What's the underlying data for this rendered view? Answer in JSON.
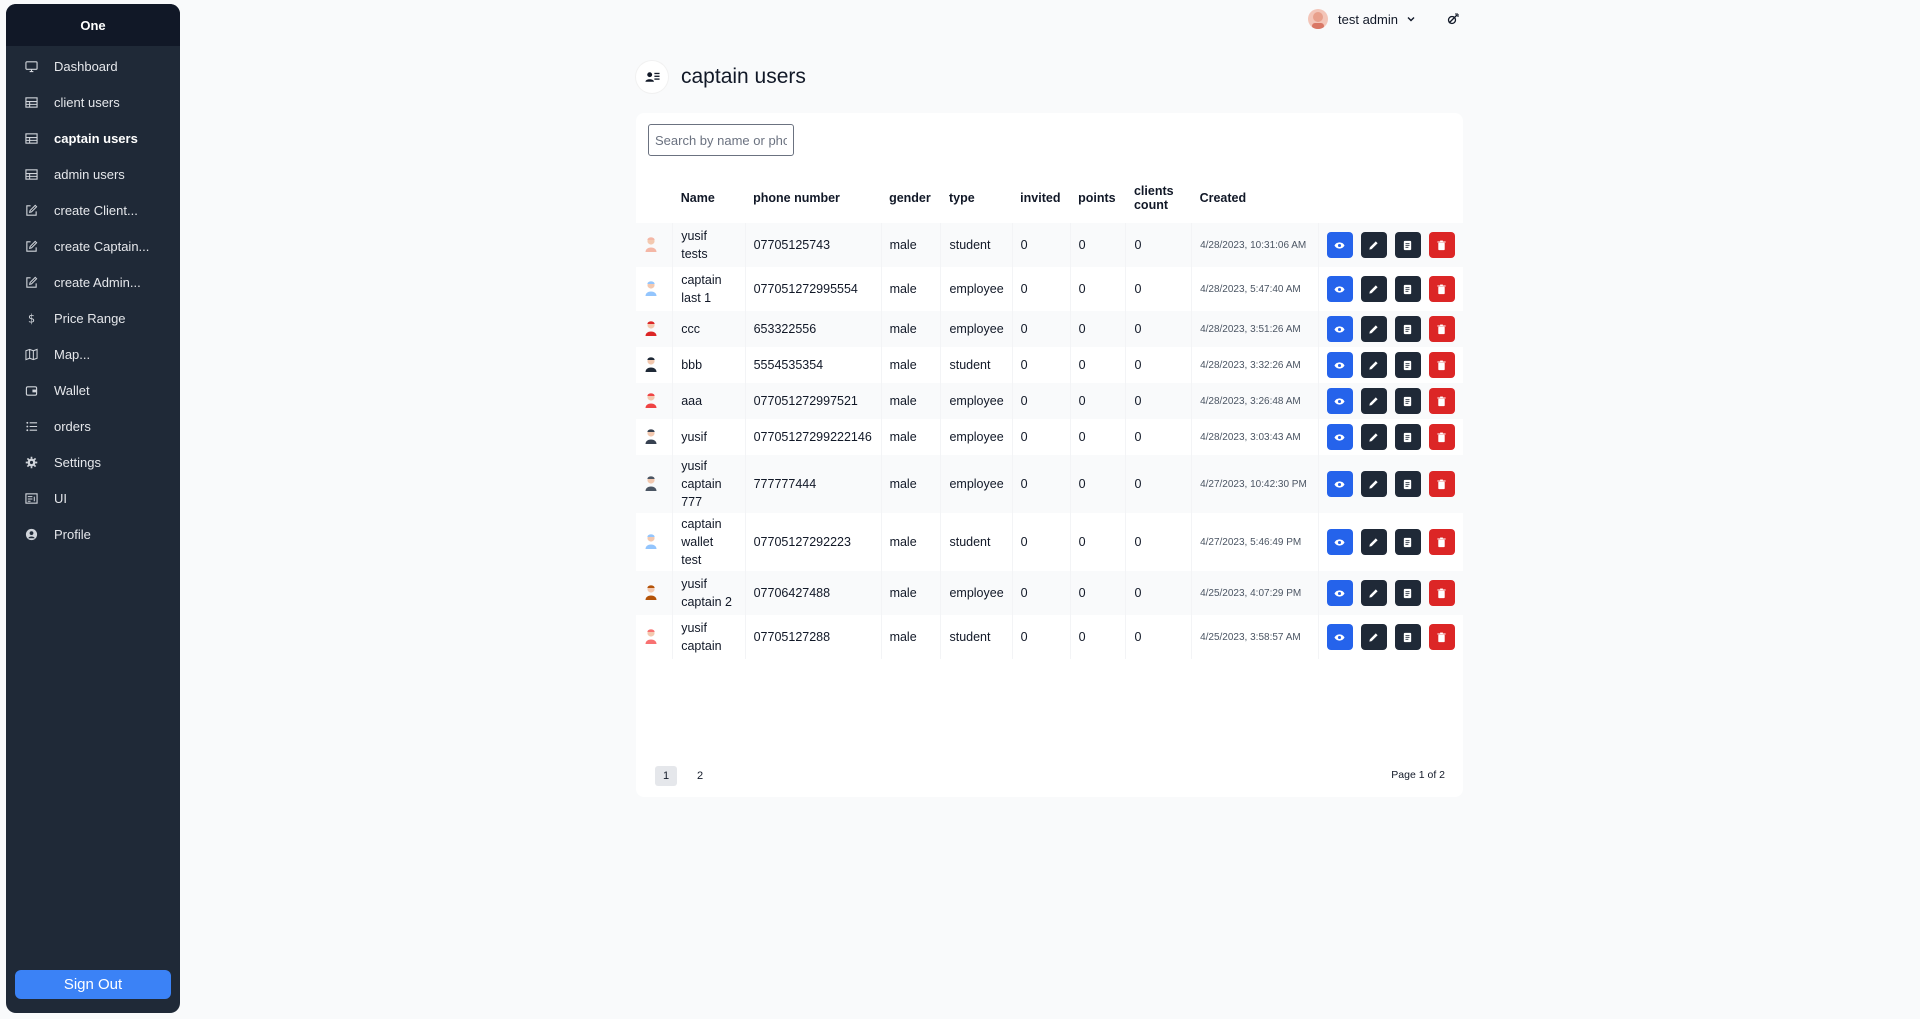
{
  "app": {
    "brand": "One"
  },
  "sidebar": {
    "items": [
      {
        "label": "Dashboard",
        "icon": "monitor-icon"
      },
      {
        "label": "client users",
        "icon": "table-icon"
      },
      {
        "label": "captain users",
        "icon": "table-icon",
        "active": true
      },
      {
        "label": "admin users",
        "icon": "table-icon"
      },
      {
        "label": "create Client...",
        "icon": "edit-square-icon"
      },
      {
        "label": "create Captain...",
        "icon": "edit-square-icon"
      },
      {
        "label": "create Admin...",
        "icon": "edit-square-icon"
      },
      {
        "label": "Price Range",
        "icon": "dollar-icon"
      },
      {
        "label": "Map...",
        "icon": "map-icon"
      },
      {
        "label": "Wallet",
        "icon": "wallet-icon"
      },
      {
        "label": "orders",
        "icon": "list-icon"
      },
      {
        "label": "Settings",
        "icon": "gear-icon"
      },
      {
        "label": "UI",
        "icon": "layout-icon"
      },
      {
        "label": "Profile",
        "icon": "user-circle-icon"
      }
    ],
    "signout_label": "Sign Out"
  },
  "topbar": {
    "user_name": "test admin"
  },
  "page": {
    "title": "captain users"
  },
  "search": {
    "placeholder": "Search by name or phone",
    "value": ""
  },
  "table": {
    "headers": {
      "name": "Name",
      "phone": "phone number",
      "gender": "gender",
      "type": "type",
      "invited": "invited",
      "points": "points",
      "clients": "clients count",
      "created": "Created"
    },
    "rows": [
      {
        "name": "yusif tests",
        "phone": "07705125743",
        "gender": "male",
        "type": "student",
        "invited": "0",
        "points": "0",
        "clients": "0",
        "created": "4/28/2023, 10:31:06 AM",
        "avatar_color": "#f4b7a6"
      },
      {
        "name": "captain last 1",
        "phone": "077051272995554",
        "gender": "male",
        "type": "employee",
        "invited": "0",
        "points": "0",
        "clients": "0",
        "created": "4/28/2023, 5:47:40 AM",
        "avatar_color": "#93c5fd"
      },
      {
        "name": "ccc",
        "phone": "653322556",
        "gender": "male",
        "type": "employee",
        "invited": "0",
        "points": "0",
        "clients": "0",
        "created": "4/28/2023, 3:51:26 AM",
        "avatar_color": "#dc2626"
      },
      {
        "name": "bbb",
        "phone": "5554535354",
        "gender": "male",
        "type": "student",
        "invited": "0",
        "points": "0",
        "clients": "0",
        "created": "4/28/2023, 3:32:26 AM",
        "avatar_color": "#1f2937"
      },
      {
        "name": "aaa",
        "phone": "077051272997521",
        "gender": "male",
        "type": "employee",
        "invited": "0",
        "points": "0",
        "clients": "0",
        "created": "4/28/2023, 3:26:48 AM",
        "avatar_color": "#ef4444"
      },
      {
        "name": "yusif",
        "phone": "07705127299222146",
        "gender": "male",
        "type": "employee",
        "invited": "0",
        "points": "0",
        "clients": "0",
        "created": "4/28/2023, 3:03:43 AM",
        "avatar_color": "#374151"
      },
      {
        "name": "yusif captain 777",
        "phone": "777777444",
        "gender": "male",
        "type": "employee",
        "invited": "0",
        "points": "0",
        "clients": "0",
        "created": "4/27/2023, 10:42:30 PM",
        "avatar_color": "#4b5563"
      },
      {
        "name": "captain wallet test",
        "phone": "07705127292223",
        "gender": "male",
        "type": "student",
        "invited": "0",
        "points": "0",
        "clients": "0",
        "created": "4/27/2023, 5:46:49 PM",
        "avatar_color": "#93c5fd"
      },
      {
        "name": "yusif captain 2",
        "phone": "07706427488",
        "gender": "male",
        "type": "employee",
        "invited": "0",
        "points": "0",
        "clients": "0",
        "created": "4/25/2023, 4:07:29 PM",
        "avatar_color": "#b45309"
      },
      {
        "name": "yusif captain",
        "phone": "07705127288",
        "gender": "male",
        "type": "student",
        "invited": "0",
        "points": "0",
        "clients": "0",
        "created": "4/25/2023, 3:58:57 AM",
        "avatar_color": "#f87171"
      }
    ]
  },
  "pagination": {
    "pages": [
      "1",
      "2"
    ],
    "current": "1",
    "info": "Page 1 of 2"
  },
  "colors": {
    "sidebar_bg": "#1f2937",
    "accent": "#3b82f6",
    "view": "#2563eb",
    "delete": "#dc2626"
  }
}
